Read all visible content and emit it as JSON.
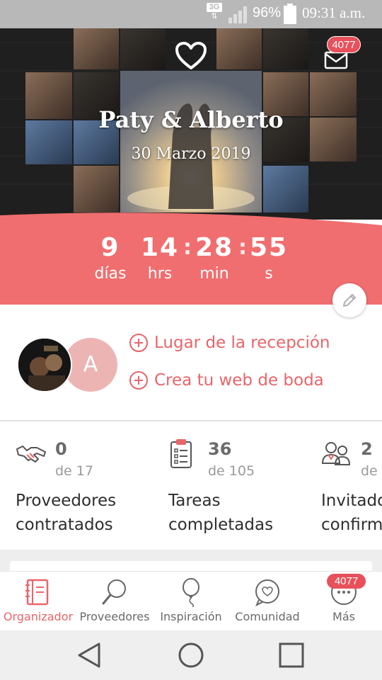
{
  "status_bar": {
    "network": "3G",
    "battery_percent": "96%",
    "battery_level": 0.96,
    "time": "09:31 a.m."
  },
  "header": {
    "couple_names": "Paty & Alberto",
    "wedding_date": "30 Marzo 2019",
    "messages_badge": "4077",
    "icons": [
      "heart-icon",
      "mail-icon"
    ]
  },
  "countdown": {
    "days": "9",
    "days_label": "días",
    "hours": "14",
    "hours_label": "hrs",
    "minutes": "28",
    "minutes_label": "min",
    "seconds": "55",
    "seconds_label": "s",
    "separator": ":"
  },
  "profile": {
    "avatar_letter": "A",
    "actions": [
      {
        "label": "Lugar de la recepción",
        "icon": "plus-circle-icon"
      },
      {
        "label": "Crea tu web de boda",
        "icon": "plus-circle-icon"
      }
    ]
  },
  "stats": [
    {
      "icon": "handshake-icon",
      "value": "0",
      "total": "de 17",
      "label_line1": "Proveedores",
      "label_line2": "contratados"
    },
    {
      "icon": "clipboard-checklist-icon",
      "value": "36",
      "total": "de 105",
      "label_line1": "Tareas",
      "label_line2": "completadas"
    },
    {
      "icon": "guests-icon",
      "value": "2",
      "total": "de",
      "label_line1": "Invitado",
      "label_line2": "confirm"
    }
  ],
  "tabs": [
    {
      "label": "Organizador",
      "icon": "notebook-icon",
      "active": true
    },
    {
      "label": "Proveedores",
      "icon": "magnifier-icon",
      "active": false
    },
    {
      "label": "Inspiración",
      "icon": "balloon-icon",
      "active": false
    },
    {
      "label": "Comunidad",
      "icon": "chat-heart-icon",
      "active": false
    },
    {
      "label": "Más",
      "icon": "more-dots-icon",
      "active": false,
      "badge": "4077"
    }
  ],
  "nav": [
    "back-icon",
    "home-icon",
    "recents-icon"
  ],
  "colors": {
    "accent": "#e8656a",
    "countdown_bg": "#f06e6f",
    "badge": "#e8505b",
    "avatar_bg": "#ecb5b4",
    "status_bar": "#b8b8b8"
  }
}
